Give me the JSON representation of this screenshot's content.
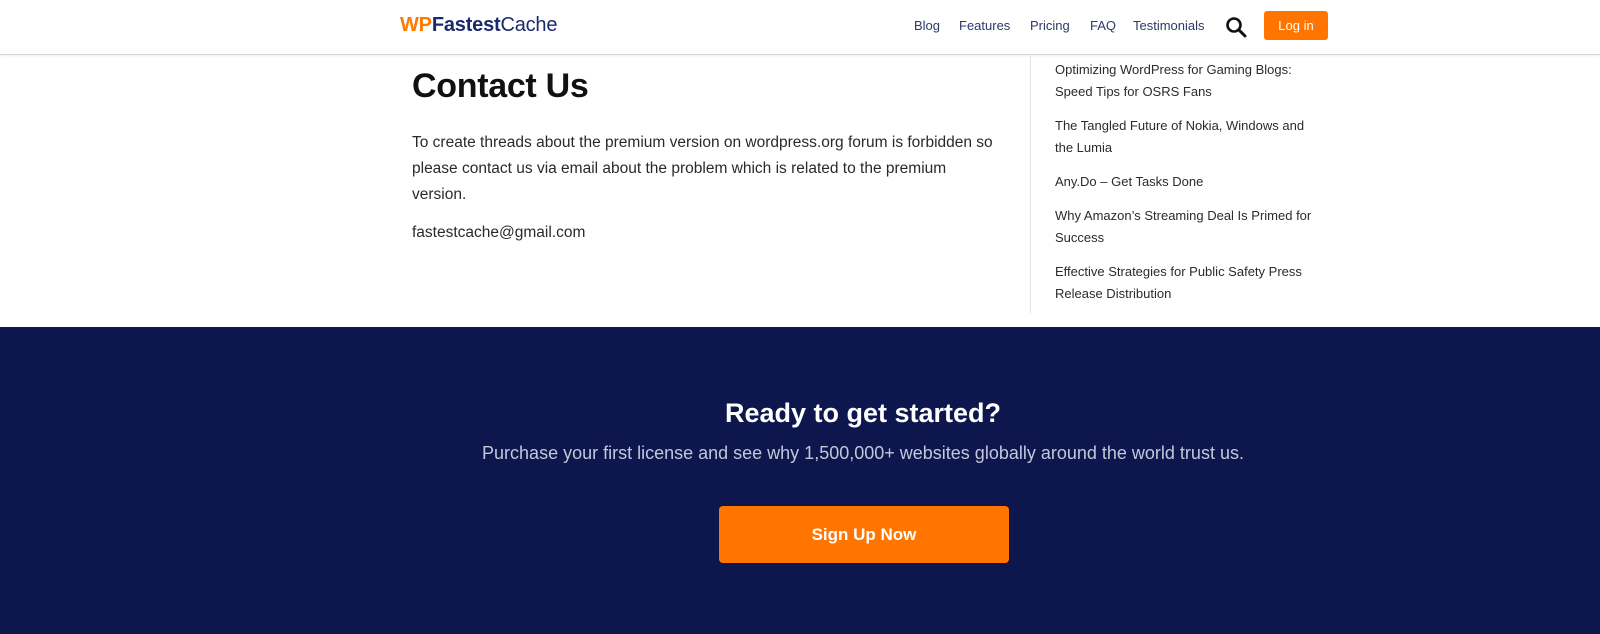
{
  "header": {
    "logo": {
      "wp": "WP",
      "fastest": "Fastest",
      "cache": "Cache"
    },
    "nav": [
      "Blog",
      "Features",
      "Pricing",
      "FAQ",
      "Testimonials"
    ],
    "search_icon": "search-icon",
    "login_label": "Log in"
  },
  "main": {
    "title": "Contact Us",
    "description": "To create threads about the premium version on wordpress.org forum is forbidden so please contact us via email about the problem which is related to the premium version.",
    "email": "fastestcache@gmail.com"
  },
  "sidebar": {
    "posts": [
      "Optimizing WordPress for Gaming Blogs: Speed Tips for OSRS Fans",
      "The Tangled Future of Nokia, Windows and the Lumia",
      "Any.Do – Get Tasks Done",
      "Why Amazon’s Streaming Deal Is Primed for Success",
      "Effective Strategies for Public Safety Press Release Distribution"
    ]
  },
  "cta": {
    "title": "Ready to get started?",
    "subtitle": "Purchase your first license and see why 1,500,000+ websites globally around the world trust us.",
    "button_label": "Sign Up Now"
  },
  "colors": {
    "accent": "#ff7500",
    "brand_navy": "#1a2a6c",
    "cta_background": "#0d174d"
  }
}
